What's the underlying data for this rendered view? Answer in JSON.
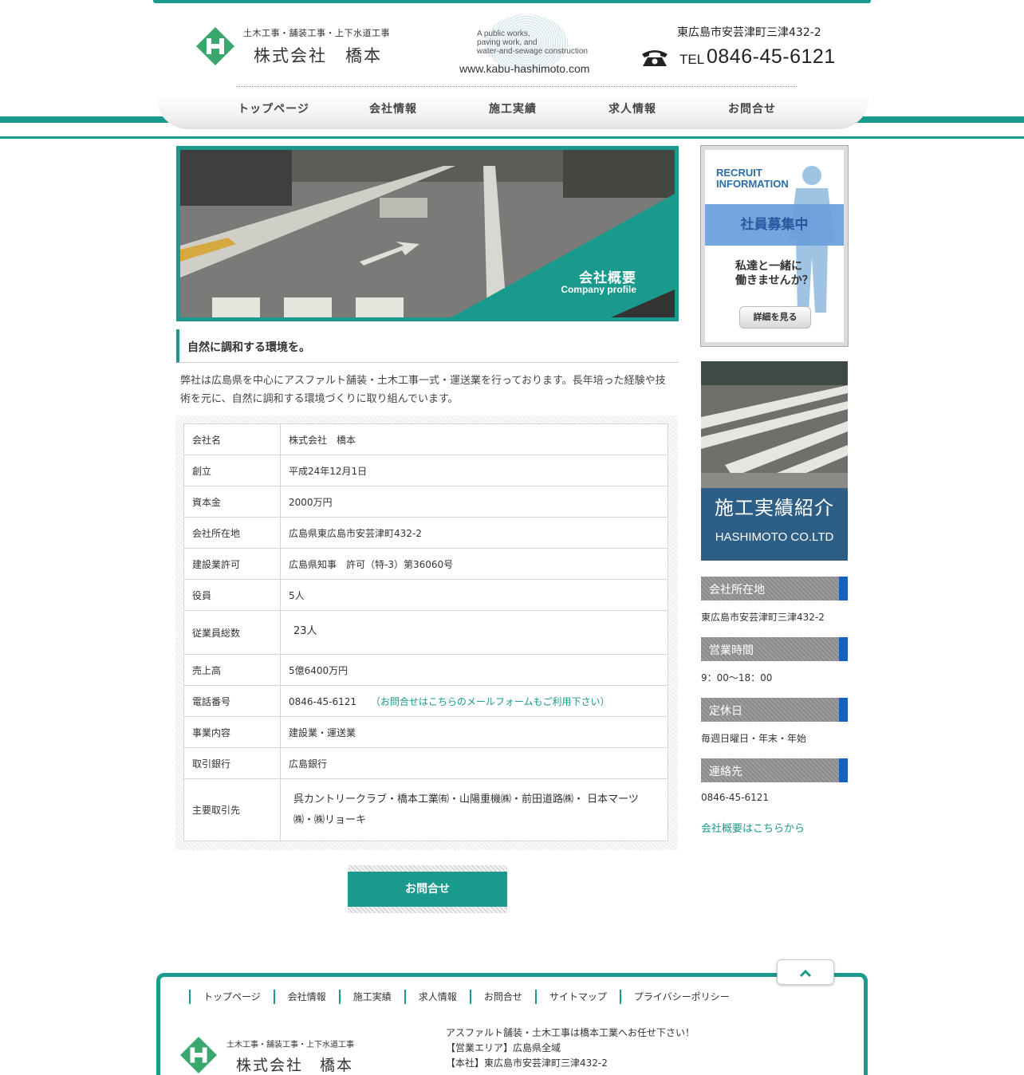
{
  "header": {
    "logo_sub": "土木工事・舗装工事・上下水道工事",
    "logo_name": "株式会社　橋本",
    "tagline": [
      "A public works,",
      "paving work, and",
      "water-and-sewage construction"
    ],
    "site_url": "www.kabu-hashimoto.com",
    "address": "東広島市安芸津町三津432-2",
    "tel_label": "TEL",
    "tel_number": "0846-45-6121"
  },
  "nav": {
    "items": [
      {
        "label": "トップページ"
      },
      {
        "label": "会社情報"
      },
      {
        "label": "施工実績"
      },
      {
        "label": "求人情報"
      },
      {
        "label": "お問合せ"
      }
    ]
  },
  "hero": {
    "title": "会社概要",
    "subtitle": "Company profile"
  },
  "main": {
    "heading": "自然に調和する環境を。",
    "intro": "弊社は広島県を中心にアスファルト舗装・土木工事一式・運送業を行っております。長年培った経験や技術を元に、自然に調和する環境づくりに取り組んでいます。",
    "table": [
      {
        "label": "会社名",
        "value": "株式会社　橋本"
      },
      {
        "label": "創立",
        "value": "平成24年12月1日"
      },
      {
        "label": "資本金",
        "value": "2000万円"
      },
      {
        "label": "会社所在地",
        "value": "広島県東広島市安芸津町432-2"
      },
      {
        "label": "建設業許可",
        "value": "広島県知事　許可（特-3）第36060号"
      },
      {
        "label": "役員",
        "value": "5人"
      },
      {
        "label": "従業員総数",
        "value": "23人"
      },
      {
        "label": "売上高",
        "value": "5億6400万円"
      },
      {
        "label": "電話番号",
        "value": "0846-45-6121",
        "link": "（お問合せはこちらのメールフォームもご利用下さい）"
      },
      {
        "label": "事業内容",
        "value": "建設業・運送業"
      },
      {
        "label": "取引銀行",
        "value": "広島銀行"
      },
      {
        "label": "主要取引先",
        "value": "呉カントリークラブ・橋本工業㈲・山陽重機㈱・前田道路㈱・ 日本マーツ㈱・㈱リョーキ"
      }
    ],
    "contact_button": "お問合せ"
  },
  "sidebar": {
    "recruit": {
      "title_line1": "RECRUIT",
      "title_line2": "INFORMATION",
      "band": "社員募集中",
      "text_line1": "私達と一緒に",
      "text_line2": "働きませんか？",
      "button": "詳細を見る"
    },
    "works": {
      "title": "施工実績紹介",
      "subtitle": "HASHIMOTO CO.LTD"
    },
    "sections": [
      {
        "heading": "会社所在地",
        "text": "東広島市安芸津町三津432-2"
      },
      {
        "heading": "営業時間",
        "text": "9：00〜18：00"
      },
      {
        "heading": "定休日",
        "text": "毎週日曜日・年末・年始"
      },
      {
        "heading": "連絡先",
        "text": "0846-45-6121"
      }
    ],
    "link": "会社概要はこちらから"
  },
  "footer": {
    "nav": [
      {
        "label": "トップページ"
      },
      {
        "label": "会社情報"
      },
      {
        "label": "施工実績"
      },
      {
        "label": "求人情報"
      },
      {
        "label": "お問合せ"
      },
      {
        "label": "サイトマップ"
      },
      {
        "label": "プライバシーポリシー"
      }
    ],
    "logo_sub": "土木工事・舗装工事・上下水道工事",
    "logo_name": "株式会社　橋本",
    "info": [
      "アスファルト舗装・土木工事は橋本工業へお任せ下さい！",
      "【営業エリア】広島県全域",
      "【本社】東広島市安芸津町三津432-2"
    ]
  },
  "colors": {
    "accent": "#1a9a8c",
    "side_accent": "#1561bd",
    "recruit_blue": "#2b6ea8"
  }
}
